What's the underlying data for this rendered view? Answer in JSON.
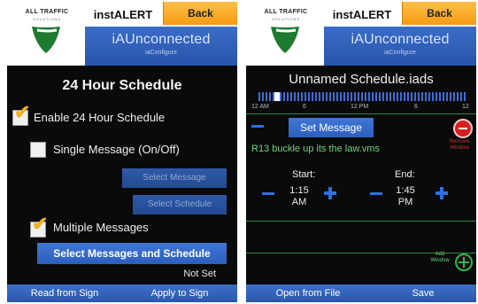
{
  "left": {
    "logo": {
      "brand": "ALL TRAFFIC",
      "tagline": "SOLUTIONS"
    },
    "app_title": "instALERT",
    "back_label": "Back",
    "connection": {
      "title": "iAUnconnected",
      "subtitle": "iaConfigure"
    },
    "page_title": "24 Hour Schedule",
    "enable_24h": {
      "label": "Enable 24 Hour Schedule",
      "checked": true
    },
    "single_message": {
      "label": "Single Message (On/Off)",
      "checked": false
    },
    "select_message_label": "Select Message",
    "select_schedule_label": "Select Schedule",
    "multiple_messages": {
      "label": "Multiple Messages",
      "checked": true
    },
    "select_messages_schedule_label": "Select Messages and Schedule",
    "status_text": "Not Set",
    "bottom": {
      "read_label": "Read from Sign",
      "apply_label": "Apply to Sign"
    }
  },
  "right": {
    "logo": {
      "brand": "ALL TRAFFIC",
      "tagline": "SOLUTIONS"
    },
    "app_title": "instALERT",
    "back_label": "Back",
    "connection": {
      "title": "iAUnconnected",
      "subtitle": "iaConfigure"
    },
    "file_title": "Unnamed Schedule.iads",
    "timeline_labels": [
      "12 AM",
      "6",
      "12 PM",
      "6",
      "12"
    ],
    "set_message_label": "Set Message",
    "remove_label": "Remove Window",
    "message_file": "R13 buckle up its the law.vms",
    "start": {
      "label": "Start:",
      "value": "1:15 AM"
    },
    "end": {
      "label": "End:",
      "value": "1:45 PM"
    },
    "add_label": "Add Window",
    "bottom": {
      "open_label": "Open from File",
      "save_label": "Save"
    }
  },
  "colors": {
    "accent_blue": "#2d5fbd",
    "back_orange": "#f59a10",
    "status_green": "#6fd27a",
    "remove_red": "#d81f1f"
  }
}
